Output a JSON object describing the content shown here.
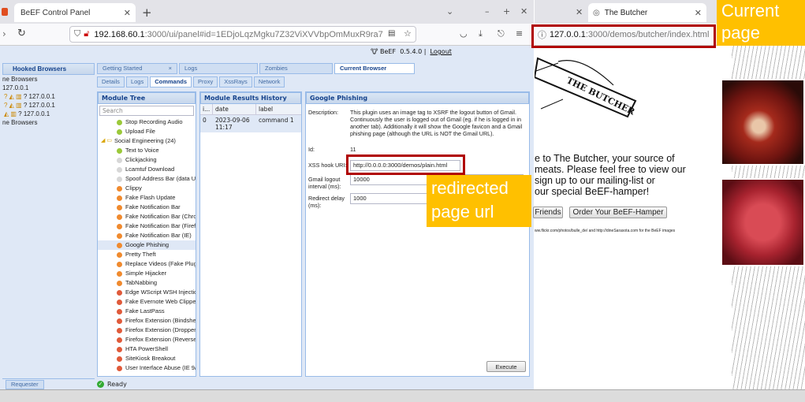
{
  "left_browser": {
    "tab_title": "BeEF Control Panel",
    "url_host": "192.168.60.1",
    "url_path": ":3000/ui/panel#id=1EDjoLqzMgku7Z32ViXVVbpOmMuxR9ra7"
  },
  "beef": {
    "brand": "BeEF",
    "version": "0.5.4.0",
    "logout": "Logout",
    "hooked_header": "Hooked Browsers",
    "hooked_lines": [
      "ne Browsers",
      "127.0.0.1",
      "? 127.0.0.1",
      "? 127.0.0.1",
      "? 127.0.0.1",
      "ne Browsers"
    ],
    "top_tabs": [
      "Getting Started",
      "Logs",
      "Zombies",
      "Current Browser"
    ],
    "sub_tabs": [
      "Details",
      "Logs",
      "Commands",
      "Proxy",
      "XssRays",
      "Network"
    ],
    "module_tree_header": "Module Tree",
    "search_placeholder": "Search",
    "tree_items": [
      {
        "label": "Stop Recording Audio",
        "color": "#9bc93a"
      },
      {
        "label": "Upload File",
        "color": "#9bc93a"
      },
      {
        "label": "Social Engineering (24)",
        "color": "folder"
      },
      {
        "label": "Text to Voice",
        "color": "#9bc93a"
      },
      {
        "label": "Clickjacking",
        "color": "#d7d7d7"
      },
      {
        "label": "Lcamtuf Download",
        "color": "#d7d7d7"
      },
      {
        "label": "Spoof Address Bar (data UR",
        "color": "#d7d7d7"
      },
      {
        "label": "Clippy",
        "color": "#f08a2e"
      },
      {
        "label": "Fake Flash Update",
        "color": "#f08a2e"
      },
      {
        "label": "Fake Notification Bar",
        "color": "#f08a2e"
      },
      {
        "label": "Fake Notification Bar (Chron",
        "color": "#f08a2e"
      },
      {
        "label": "Fake Notification Bar (Firefo",
        "color": "#f08a2e"
      },
      {
        "label": "Fake Notification Bar (IE)",
        "color": "#f08a2e"
      },
      {
        "label": "Google Phishing",
        "color": "#f08a2e"
      },
      {
        "label": "Pretty Theft",
        "color": "#f08a2e"
      },
      {
        "label": "Replace Videos (Fake Plugi",
        "color": "#f08a2e"
      },
      {
        "label": "Simple Hijacker",
        "color": "#f08a2e"
      },
      {
        "label": "TabNabbing",
        "color": "#f08a2e"
      },
      {
        "label": "Edge WScript WSH Injection",
        "color": "#e05a3a"
      },
      {
        "label": "Fake Evernote Web Clipper",
        "color": "#e05a3a"
      },
      {
        "label": "Fake LastPass",
        "color": "#e05a3a"
      },
      {
        "label": "Firefox Extension (Bindshell",
        "color": "#e05a3a"
      },
      {
        "label": "Firefox Extension (Dropper)",
        "color": "#e05a3a"
      },
      {
        "label": "Firefox Extension (Reverse S",
        "color": "#e05a3a"
      },
      {
        "label": "HTA PowerShell",
        "color": "#e05a3a"
      },
      {
        "label": "SiteKiosk Breakout",
        "color": "#e05a3a"
      },
      {
        "label": "User Interface Abuse (IE 9/1",
        "color": "#e05a3a"
      }
    ],
    "history_header": "Module Results History",
    "history_cols": [
      "i...",
      "date",
      "label"
    ],
    "history_row": {
      "id": "0",
      "date": "2023-09-06 11:17",
      "label": "command 1"
    },
    "phish_header": "Google Phishing",
    "desc_label": "Description:",
    "desc_text": "This plugin uses an image tag to XSRF the logout button of Gmail. Continuously the user is logged out of Gmail (eg. if he is logged in in another tab). Additionally it will show the Google favicon and a Gmail phishing page (although the URL is NOT the Gmail URL).",
    "id_label": "Id:",
    "id_value": "11",
    "xss_label": "XSS hook URI:",
    "xss_value": "http://0.0.0.0:3000/demos/plain.html",
    "gmail_label": "Gmail logout interval (ms):",
    "gmail_value": "10000",
    "redirect_label": "Redirect delay (ms):",
    "redirect_value": "1000",
    "execute": "Execute",
    "requester": "Requester",
    "status": "Ready"
  },
  "right_browser": {
    "tab_title": "The Butcher",
    "url_host": "127.0.0.1",
    "url_path": ":3000/demos/butcher/index.html",
    "logo_text": "THE BUTCHER",
    "welcome_lines": [
      "e to The Butcher, your source of",
      "meats. Please feel free to view our",
      "sign up to our mailing-list or",
      "our special BeEF-hamper!"
    ],
    "btn_friends": "Friends",
    "btn_hamper": "Order Your BeEF-Hamper",
    "credits": "ww.flickr.com/photos/bulle_de/ and http://dineSarasota.com for the BeEF images"
  },
  "annotations": {
    "current_page": "Current page",
    "redirected": "redirected page url"
  }
}
